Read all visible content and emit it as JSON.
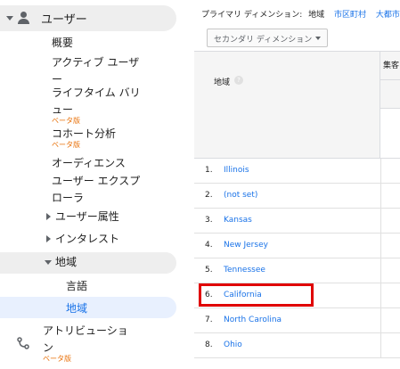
{
  "nav": {
    "section_label": "ユーザー",
    "items": [
      {
        "label": "概要"
      },
      {
        "label_lines": [
          "アクティブ ユーザ",
          "ー"
        ]
      },
      {
        "label_lines": [
          "ライフタイム バリ",
          "ュー"
        ],
        "badge": "ベータ版"
      },
      {
        "label": "コホート分析",
        "badge": "ベータ版"
      },
      {
        "label": "オーディエンス"
      },
      {
        "label_lines": [
          "ユーザー エクスプ",
          "ローラ"
        ]
      }
    ],
    "groups": [
      {
        "label": "ユーザー属性",
        "expanded": false
      },
      {
        "label": "インタレスト",
        "expanded": false
      },
      {
        "label": "地域",
        "expanded": true
      }
    ],
    "geo_children": [
      {
        "label": "言語",
        "selected": false
      },
      {
        "label": "地域",
        "selected": true
      }
    ],
    "attribution": {
      "label_lines": [
        "アトリビューショ",
        "ン"
      ],
      "badge": "ベータ版"
    }
  },
  "primary_dimension": {
    "label": "プライマリ ディメンション:",
    "value": "地域",
    "options": [
      "市区町村",
      "大都市圏"
    ]
  },
  "secondary_dimension": {
    "label": "セカンダリ ディメンション"
  },
  "table": {
    "dimension_header": "地域",
    "group_header": "集客",
    "rows": [
      {
        "index": "1.",
        "value": "Illinois"
      },
      {
        "index": "2.",
        "value": "(not set)"
      },
      {
        "index": "3.",
        "value": "Kansas"
      },
      {
        "index": "4.",
        "value": "New Jersey"
      },
      {
        "index": "5.",
        "value": "Tennessee"
      },
      {
        "index": "6.",
        "value": "California"
      },
      {
        "index": "7.",
        "value": "North Carolina"
      },
      {
        "index": "8.",
        "value": "Ohio"
      }
    ]
  },
  "highlight": {
    "row_index": 5,
    "color": "#e00000"
  },
  "colors": {
    "link": "#1a73e8",
    "beta": "#e8710a",
    "nav_active": "#eeeeee",
    "nav_selected": "#e8f0fe"
  }
}
